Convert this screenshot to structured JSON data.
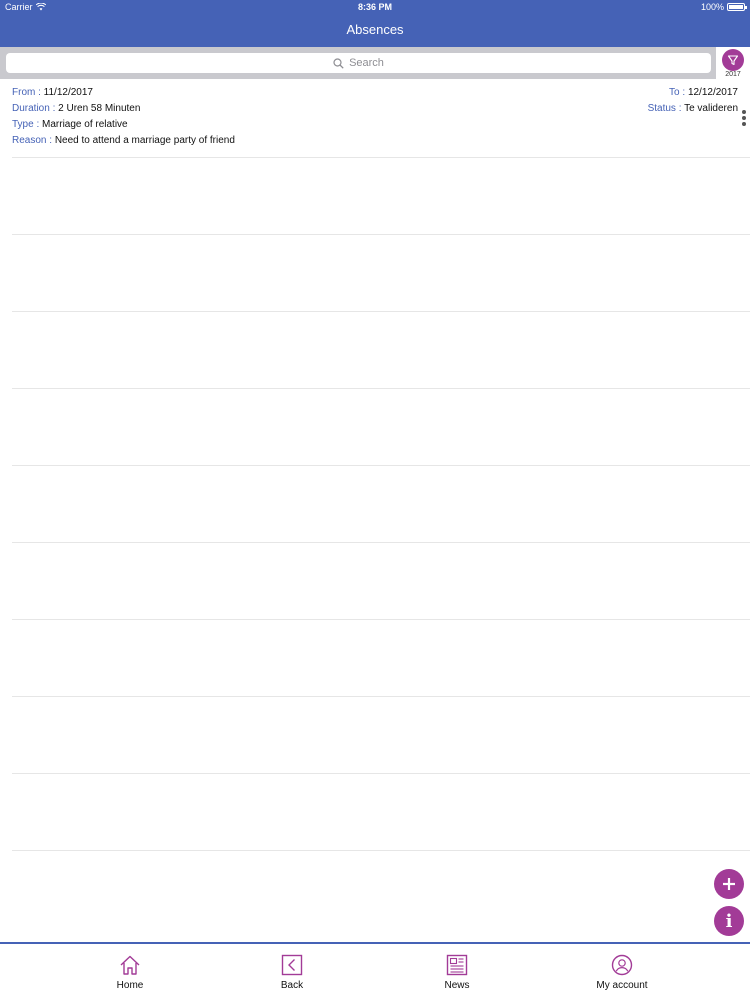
{
  "status_bar": {
    "carrier": "Carrier",
    "time": "8:36 PM",
    "battery": "100%"
  },
  "nav": {
    "title": "Absences"
  },
  "search": {
    "placeholder": "Search"
  },
  "filter": {
    "year": "2017",
    "icon": "filter-icon"
  },
  "record": {
    "from_label": "From :",
    "from_value": "11/12/2017",
    "to_label": "To :",
    "to_value": "12/12/2017",
    "duration_label": "Duration :",
    "duration_value": "2 Uren 58 Minuten",
    "status_label": "Status :",
    "status_value": "Te valideren",
    "type_label": "Type :",
    "type_value": "Marriage of relative",
    "reason_label": "Reason :",
    "reason_value": "Need to attend a marriage party of friend"
  },
  "fabs": {
    "add_icon": "plus-icon",
    "info_icon": "info-icon",
    "info_glyph": "i"
  },
  "tabs": [
    {
      "label": "Home",
      "icon": "home-icon"
    },
    {
      "label": "Back",
      "icon": "back-icon"
    },
    {
      "label": "News",
      "icon": "news-icon"
    },
    {
      "label": "My account",
      "icon": "account-icon"
    }
  ],
  "colors": {
    "header": "#4562b6",
    "accent": "#a23b97",
    "label": "#4562b6"
  }
}
